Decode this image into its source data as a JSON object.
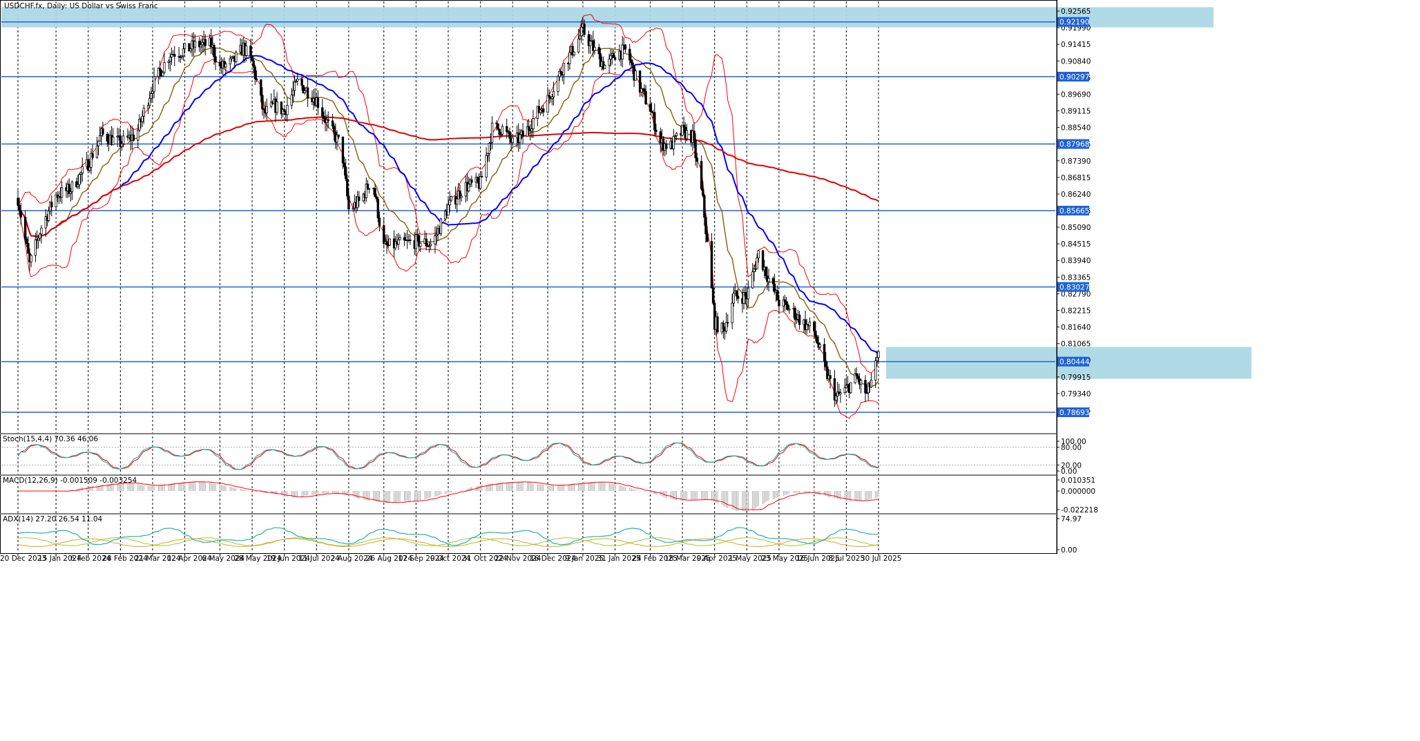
{
  "chart_data": {
    "type": "candlestick",
    "title": "USDCHF.fx, Daily:  US Dollar vs Swiss Franc",
    "symbol": "USDCHF.fx",
    "timeframe": "Daily",
    "description": "US Dollar vs Swiss Franc",
    "colors": {
      "candle": "#000000",
      "support_lines": "#1e63d6",
      "zones": "#add8e6",
      "bollinger": "#ff0000",
      "ma_fast": "#8b6914",
      "ma_mid": "#0000ff",
      "ma_slow": "#dd0000",
      "stoch_main": "#20b2aa",
      "stoch_signal": "#ff0000",
      "macd_hist": "#a9a9a9",
      "macd_signal": "#ff0000",
      "adx_main": "#20b2aa",
      "adx_plus": "#9acd32",
      "adx_minus": "#daa520"
    },
    "price_axis": {
      "range": [
        0.78,
        0.929
      ],
      "ticks": [
        "0.92565",
        "0.91990",
        "0.91415",
        "0.90840",
        "0.90265",
        "0.89690",
        "0.89115",
        "0.88540",
        "0.87965",
        "0.87390",
        "0.86815",
        "0.86240",
        "0.85665",
        "0.85090",
        "0.84515",
        "0.83940",
        "0.83365",
        "0.82790",
        "0.82215",
        "0.81640",
        "0.81065",
        "0.80490",
        "0.79915",
        "0.79340",
        "0.78765"
      ]
    },
    "date_ticks": [
      "20 Dec 2023",
      "15 Jan 2024",
      "6 Feb 2024",
      "28 Feb 2024",
      "21 Mar 2024",
      "12 Apr 2024",
      "6 May 2024",
      "28 May 2024",
      "19 Jun 2024",
      "11 Jul 2024",
      "2 Aug 2024",
      "26 Aug 2024",
      "17 Sep 2024",
      "9 Oct 2024",
      "31 Oct 2024",
      "22 Nov 2024",
      "16 Dec 2024",
      "9 Jan 2025",
      "31 Jan 2025",
      "24 Feb 2025",
      "18 Mar 2025",
      "9 Apr 2025",
      "1 May 2025",
      "23 May 2025",
      "16 Jun 2025",
      "8 Jul 2025",
      "30 Jul 2025"
    ],
    "horizontal_levels": [
      "0.92190",
      "0.90297",
      "0.87968",
      "0.85665",
      "0.83027",
      "0.80444",
      "0.78693"
    ],
    "zones": [
      {
        "from_date": "20 Dec 2023",
        "to_date": "30 Jul 2025",
        "price_low": 0.92,
        "price_high": 0.927
      },
      {
        "from_date": "9 Apr 2025",
        "to_date": "30 Jul 2025",
        "price_low": 0.7985,
        "price_high": 0.8095
      }
    ],
    "price_path": [
      [
        "20 Dec 2023",
        0.861
      ],
      [
        "28 Dec 2023",
        0.838
      ],
      [
        "5 Jan 2024",
        0.851
      ],
      [
        "15 Jan 2024",
        0.862
      ],
      [
        "25 Jan 2024",
        0.864
      ],
      [
        "6 Feb 2024",
        0.873
      ],
      [
        "15 Feb 2024",
        0.883
      ],
      [
        "28 Feb 2024",
        0.88
      ],
      [
        "10 Mar 2024",
        0.883
      ],
      [
        "21 Mar 2024",
        0.9
      ],
      [
        "2 Apr 2024",
        0.911
      ],
      [
        "12 Apr 2024",
        0.912
      ],
      [
        "20 Apr 2024",
        0.914
      ],
      [
        "30 Apr 2024",
        0.914
      ],
      [
        "6 May 2024",
        0.906
      ],
      [
        "15 May 2024",
        0.908
      ],
      [
        "22 May 2024",
        0.913
      ],
      [
        "28 May 2024",
        0.908
      ],
      [
        "5 Jun 2024",
        0.89
      ],
      [
        "12 Jun 2024",
        0.893
      ],
      [
        "19 Jun 2024",
        0.891
      ],
      [
        "28 Jun 2024",
        0.901
      ],
      [
        "5 Jul 2024",
        0.898
      ],
      [
        "11 Jul 2024",
        0.895
      ],
      [
        "20 Jul 2024",
        0.885
      ],
      [
        "28 Jul 2024",
        0.879
      ],
      [
        "2 Aug 2024",
        0.857
      ],
      [
        "10 Aug 2024",
        0.86
      ],
      [
        "18 Aug 2024",
        0.868
      ],
      [
        "26 Aug 2024",
        0.844
      ],
      [
        "5 Sep 2024",
        0.845
      ],
      [
        "17 Sep 2024",
        0.846
      ],
      [
        "28 Sep 2024",
        0.845
      ],
      [
        "9 Oct 2024",
        0.858
      ],
      [
        "20 Oct 2024",
        0.865
      ],
      [
        "31 Oct 2024",
        0.866
      ],
      [
        "8 Nov 2024",
        0.885
      ],
      [
        "15 Nov 2024",
        0.885
      ],
      [
        "22 Nov 2024",
        0.88
      ],
      [
        "30 Nov 2024",
        0.883
      ],
      [
        "8 Dec 2024",
        0.89
      ],
      [
        "16 Dec 2024",
        0.895
      ],
      [
        "26 Dec 2024",
        0.906
      ],
      [
        "3 Jan 2025",
        0.913
      ],
      [
        "9 Jan 2025",
        0.919
      ],
      [
        "18 Jan 2025",
        0.911
      ],
      [
        "25 Jan 2025",
        0.906
      ],
      [
        "31 Jan 2025",
        0.911
      ],
      [
        "8 Feb 2025",
        0.912
      ],
      [
        "15 Feb 2025",
        0.901
      ],
      [
        "24 Feb 2025",
        0.892
      ],
      [
        "3 Mar 2025",
        0.88
      ],
      [
        "10 Mar 2025",
        0.879
      ],
      [
        "18 Mar 2025",
        0.884
      ],
      [
        "25 Mar 2025",
        0.882
      ],
      [
        "1 Apr 2025",
        0.86
      ],
      [
        "5 Apr 2025",
        0.84
      ],
      [
        "9 Apr 2025",
        0.818
      ],
      [
        "15 Apr 2025",
        0.815
      ],
      [
        "22 Apr 2025",
        0.827
      ],
      [
        "1 May 2025",
        0.827
      ],
      [
        "9 May 2025",
        0.842
      ],
      [
        "16 May 2025",
        0.833
      ],
      [
        "23 May 2025",
        0.825
      ],
      [
        "1 Jun 2025",
        0.822
      ],
      [
        "8 Jun 2025",
        0.818
      ],
      [
        "16 Jun 2025",
        0.815
      ],
      [
        "24 Jun 2025",
        0.801
      ],
      [
        "1 Jul 2025",
        0.792
      ],
      [
        "8 Jul 2025",
        0.795
      ],
      [
        "15 Jul 2025",
        0.799
      ],
      [
        "22 Jul 2025",
        0.793
      ],
      [
        "30 Jul 2025",
        0.806
      ]
    ],
    "indicators": [
      {
        "name": "Stoch",
        "label": "Stoch(15,4,4) 70.36 46.06",
        "axis_ticks": [
          "100.00",
          "80.00",
          "20.00",
          "0.00"
        ]
      },
      {
        "name": "MACD",
        "label": "MACD(12,26,9) -0.001509 -0.003254",
        "axis_ticks": [
          "0.010351",
          "0.000000",
          "-0.022218"
        ]
      },
      {
        "name": "ADX",
        "label": "ADX(14) 27.20 26.54 11.04",
        "axis_ticks": [
          "74.97",
          "0.00"
        ]
      }
    ]
  }
}
